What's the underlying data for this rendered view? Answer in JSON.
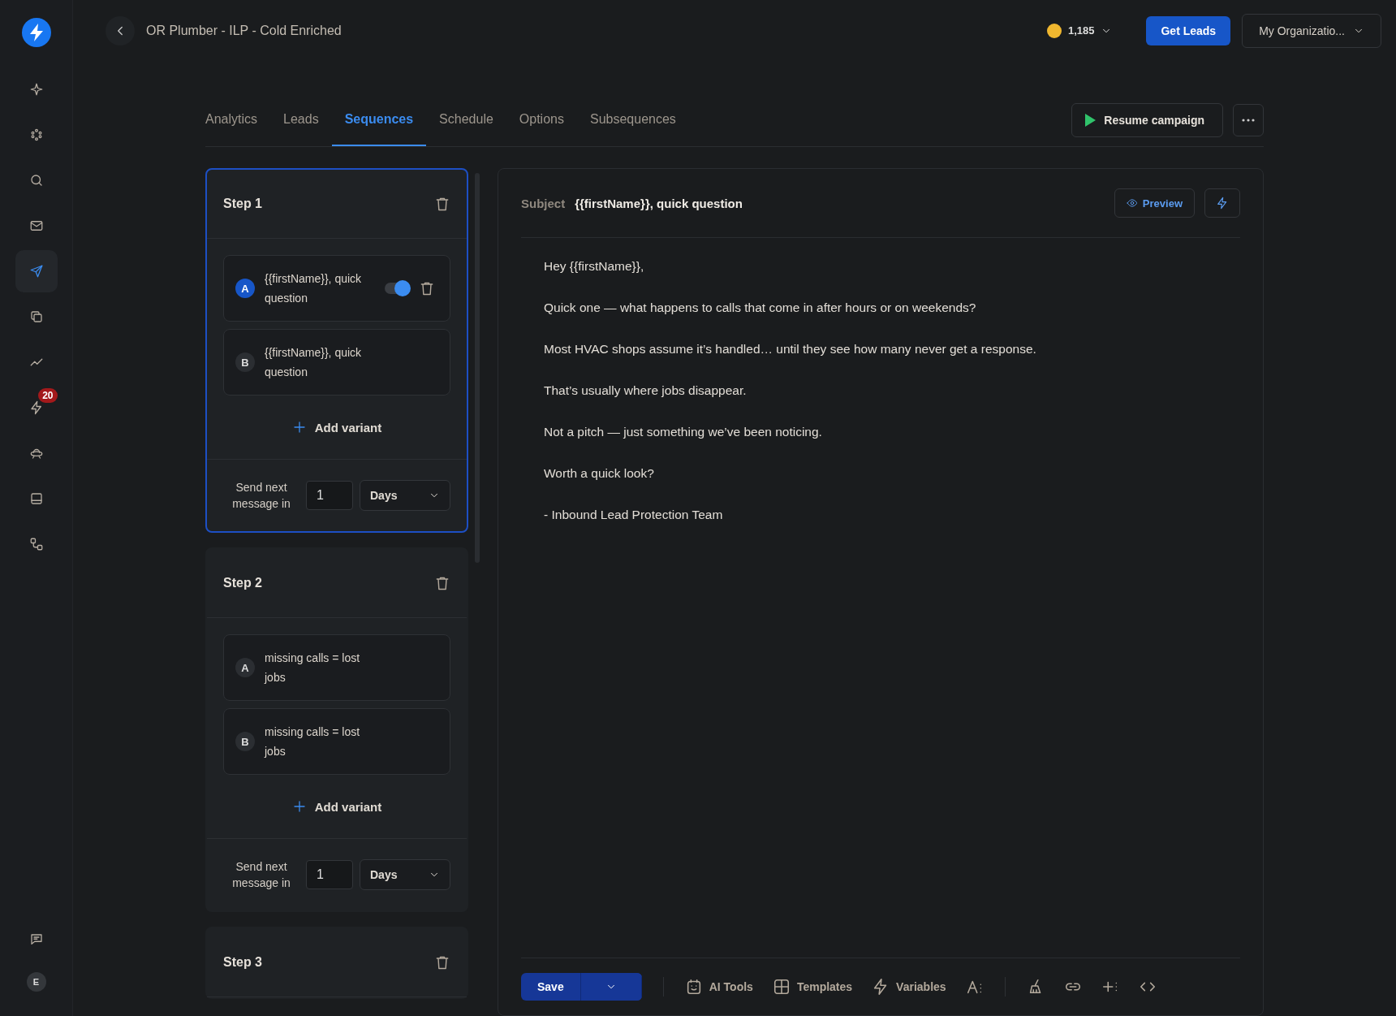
{
  "sidebar": {
    "items": [
      {
        "kind": "sparkle",
        "selected": false
      },
      {
        "kind": "dots",
        "selected": false
      },
      {
        "kind": "search",
        "selected": false
      },
      {
        "kind": "mail",
        "selected": false
      },
      {
        "kind": "send",
        "selected": true
      },
      {
        "kind": "copy",
        "selected": false
      },
      {
        "kind": "trend",
        "selected": false
      },
      {
        "kind": "bolt",
        "selected": false,
        "badge": "20"
      },
      {
        "kind": "ufo",
        "selected": false
      },
      {
        "kind": "inbox",
        "selected": false
      },
      {
        "kind": "nodes",
        "selected": false
      }
    ],
    "bottom_items": [
      {
        "kind": "chat",
        "selected": false
      }
    ],
    "avatar": "E"
  },
  "header": {
    "title": "OR Plumber - ILP - Cold Enriched",
    "credits": "1,185",
    "primary_button": "Get Leads",
    "org_menu": "My Organizatio..."
  },
  "tabs": [
    {
      "label": "Analytics",
      "selected": false
    },
    {
      "label": "Leads",
      "selected": false
    },
    {
      "label": "Sequences",
      "selected": true
    },
    {
      "label": "Schedule",
      "selected": false
    },
    {
      "label": "Options",
      "selected": false
    },
    {
      "label": "Subsequences",
      "selected": false
    }
  ],
  "resume_button": "Resume campaign",
  "steps": [
    {
      "title": "Step 1",
      "selected": true,
      "variants": [
        {
          "letter": "A",
          "subject": "{{firstName}}, quick question",
          "selected": true
        },
        {
          "letter": "B",
          "subject": "{{firstName}}, quick question",
          "selected": false
        }
      ],
      "add_variant": "Add variant",
      "delay_label": "Send next message in",
      "delay_value": "1",
      "delay_unit": "Days"
    },
    {
      "title": "Step 2",
      "selected": false,
      "variants": [
        {
          "letter": "A",
          "subject": "missing calls = lost jobs",
          "selected": false
        },
        {
          "letter": "B",
          "subject": "missing calls = lost jobs",
          "selected": false
        }
      ],
      "add_variant": "Add variant",
      "delay_label": "Send next message in",
      "delay_value": "1",
      "delay_unit": "Days"
    },
    {
      "title": "Step 3",
      "selected": false
    }
  ],
  "editor": {
    "subject_label": "Subject",
    "subject": "{{firstName}}, quick question",
    "preview_button": "Preview",
    "body": [
      "Hey {{firstName}},",
      "Quick one — what happens to calls that come in after hours or on weekends?",
      "Most HVAC shops assume it’s handled… until they see how many never get a response.",
      "That’s usually where jobs disappear.",
      "Not a pitch — just something we’ve been noticing.",
      "Worth a quick look?",
      "- Inbound Lead Protection Team"
    ],
    "save_button": "Save",
    "tools": [
      {
        "kind": "ai",
        "label": "AI Tools"
      },
      {
        "kind": "templates",
        "label": "Templates"
      },
      {
        "kind": "variables",
        "label": "Variables"
      },
      {
        "kind": "font"
      },
      {
        "kind": "clean"
      },
      {
        "kind": "link"
      },
      {
        "kind": "insert"
      },
      {
        "kind": "code"
      }
    ]
  }
}
